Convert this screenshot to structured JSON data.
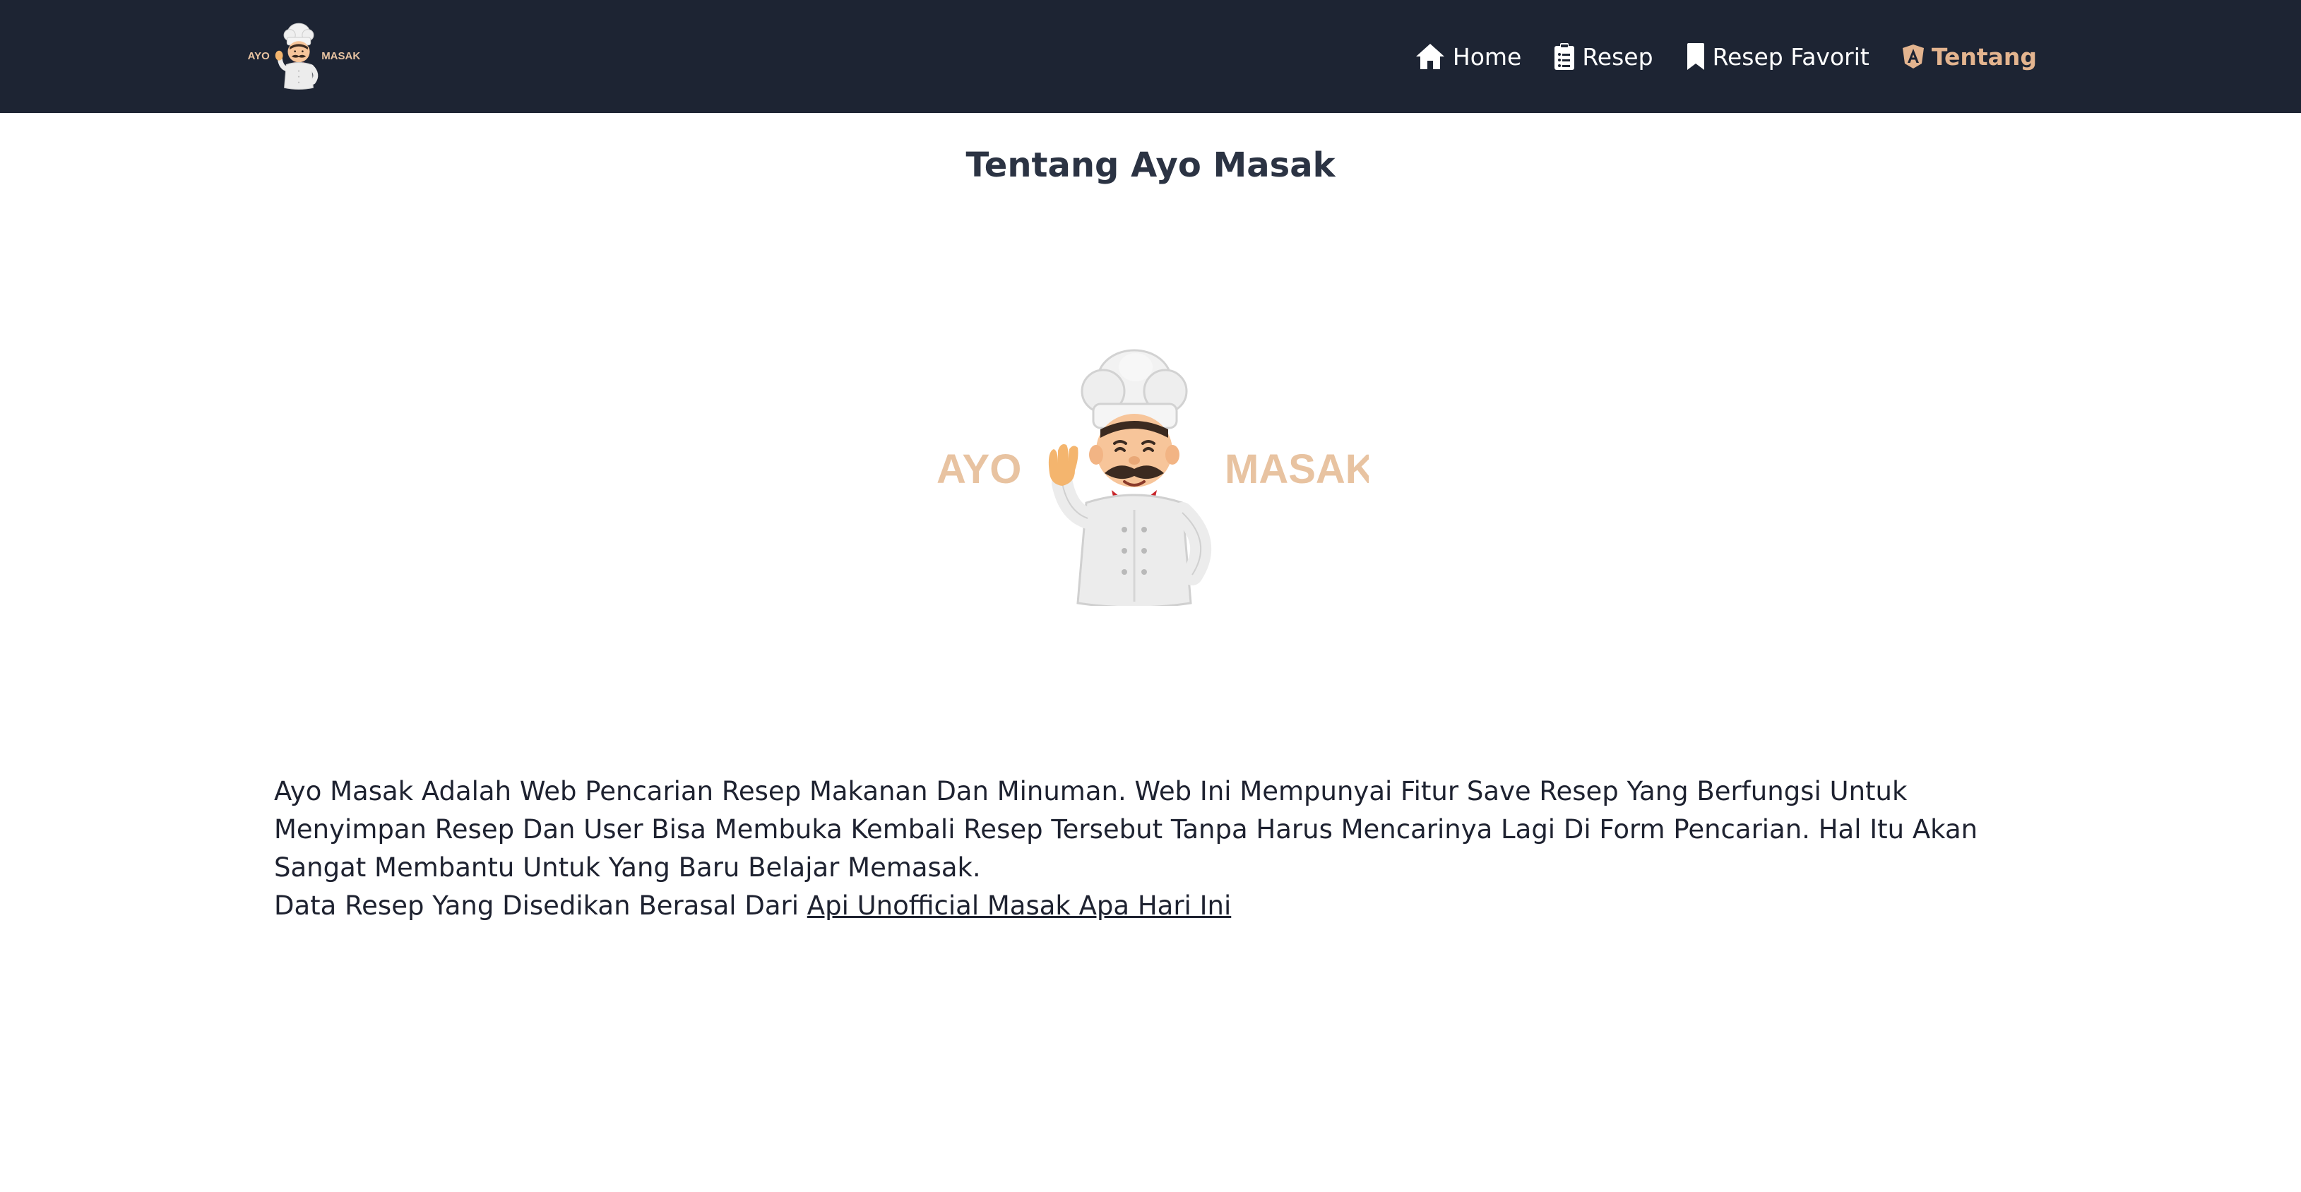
{
  "brand": {
    "word_left": "AYO",
    "word_right": "MASAK",
    "color": "#e8c3a1"
  },
  "nav": {
    "items": [
      {
        "label": "Home",
        "icon": "home-icon"
      },
      {
        "label": "Resep",
        "icon": "clipboard-list-icon"
      },
      {
        "label": "Resep Favorit",
        "icon": "bookmark-icon"
      },
      {
        "label": "Tentang",
        "icon": "angular-icon",
        "active": true
      }
    ]
  },
  "page": {
    "title": "Tentang Ayo Masak"
  },
  "about": {
    "paragraph": "Ayo Masak Adalah Web Pencarian Resep Makanan Dan Minuman. Web Ini Mempunyai Fitur Save Resep Yang Berfungsi Untuk Menyimpan Resep Dan User Bisa Membuka Kembali Resep Tersebut Tanpa Harus Mencarinya Lagi Di Form Pencarian. Hal Itu Akan Sangat Membantu Untuk Yang Baru Belajar Memasak.",
    "source_prefix": "Data Resep Yang Disedikan Berasal Dari ",
    "source_link": "Api Unofficial Masak Apa Hari Ini"
  },
  "colors": {
    "navbar_bg": "#1d2433",
    "accent": "#e3b48f",
    "text": "#1e2230"
  }
}
